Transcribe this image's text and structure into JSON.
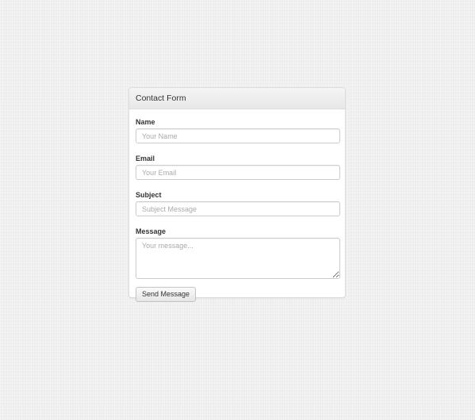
{
  "panel": {
    "title": "Contact Form"
  },
  "form": {
    "name": {
      "label": "Name",
      "placeholder": "Your Name",
      "value": ""
    },
    "email": {
      "label": "Email",
      "placeholder": "Your Email",
      "value": ""
    },
    "subject": {
      "label": "Subject",
      "placeholder": "Subject Message",
      "value": ""
    },
    "message": {
      "label": "Message",
      "placeholder": "Your message...",
      "value": ""
    },
    "submit_label": "Send Message"
  }
}
